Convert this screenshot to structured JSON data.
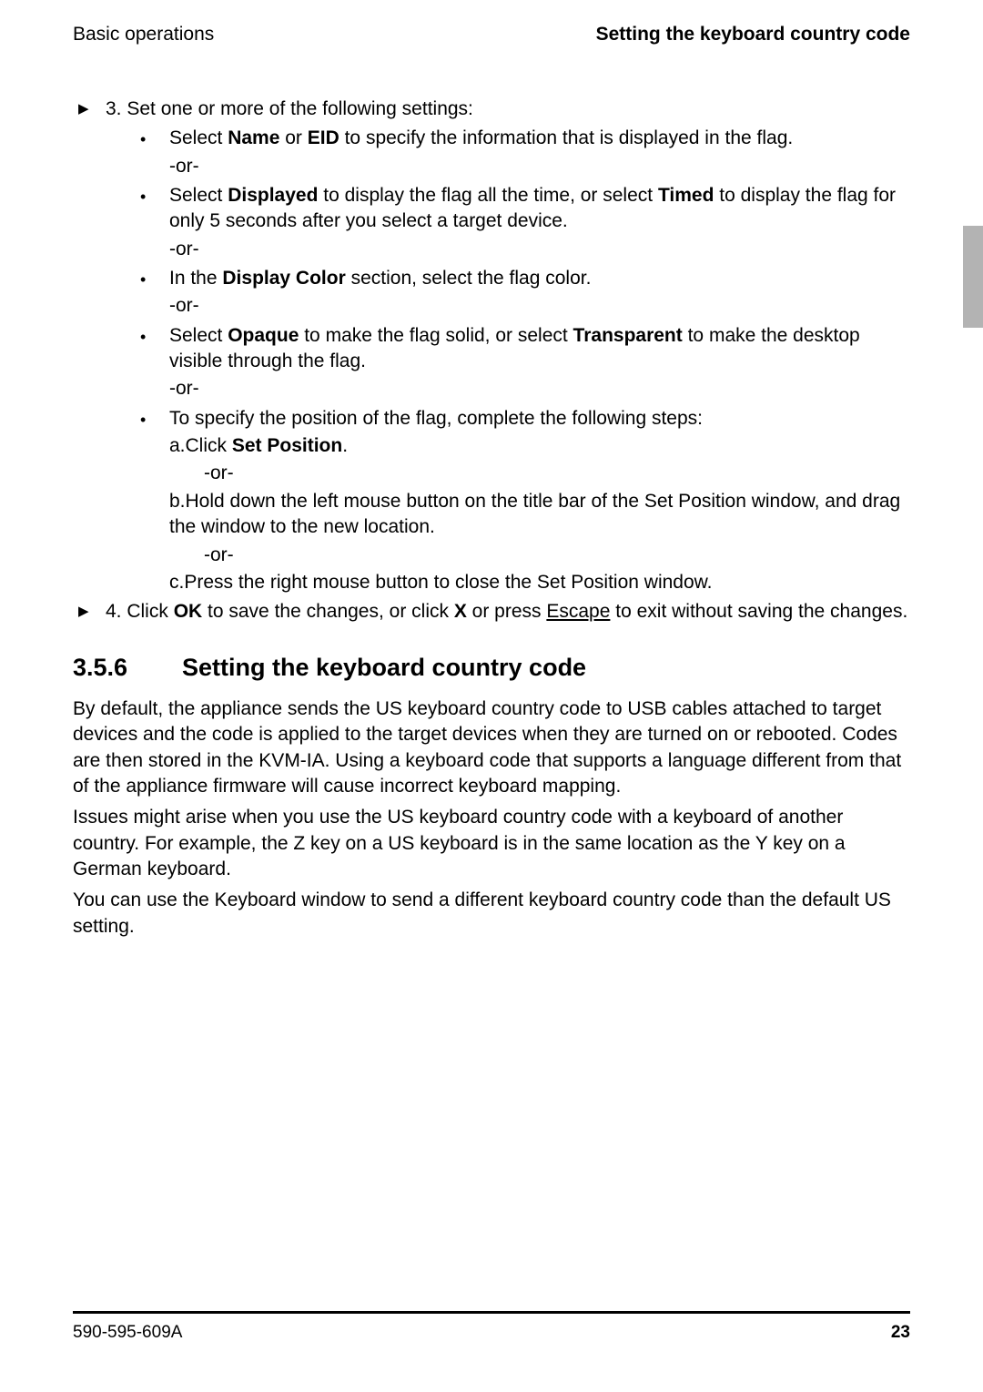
{
  "header": {
    "left": "Basic operations",
    "right": "Setting the keyboard country code"
  },
  "step3": {
    "intro": "3. Set one or more of the following settings:",
    "b1_pre": "Select ",
    "b1_name": "Name",
    "b1_mid": " or ",
    "b1_eid": "EID",
    "b1_post": " to specify the information that is displayed in the flag.",
    "b2_pre": "Select ",
    "b2_disp": "Displayed",
    "b2_mid": " to display the flag all the time, or select ",
    "b2_timed": "Timed",
    "b2_post": " to display the flag for only 5 seconds after you select a target device.",
    "b3_pre": "In the ",
    "b3_bold": "Display Color",
    "b3_post": " section, select the flag color.",
    "b4_pre": "Select ",
    "b4_op": "Opaque",
    "b4_mid": " to make the flag solid, or select ",
    "b4_tr": "Transparent",
    "b4_post": " to make the desktop visible through the flag.",
    "b5_intro": "To specify the position of the flag, complete the following steps:",
    "b5_a_pre": "a.Click ",
    "b5_a_bold": "Set Position",
    "b5_a_post": ".",
    "b5_b": "b.Hold down the left mouse button on the title bar of the Set Position window, and drag the window to the new location.",
    "b5_c": "c.Press the right mouse button to close the Set Position window.",
    "or": "-or-"
  },
  "step4": {
    "pre": "4. Click ",
    "ok": "OK",
    "mid1": " to save the changes, or click ",
    "x": "X",
    "mid2": " or press ",
    "esc": "Escape",
    "post": " to exit without saving the changes."
  },
  "section": {
    "num": "3.5.6",
    "title": "Setting the keyboard country code",
    "p1": "By default, the appliance sends the US keyboard country code to USB cables attached to target devices and the code is applied to the target devices when they are turned on or rebooted. Codes are then stored in the KVM-IA. Using a keyboard code that supports a language different from that of the appliance firmware will cause incorrect keyboard mapping.",
    "p2": "Issues might arise when you use the US keyboard country code with a keyboard of another country. For example, the Z key on a US keyboard is in the same location as the Y key on a German keyboard.",
    "p3": "You can use the Keyboard window to send a different keyboard country code than the default US setting."
  },
  "footer": {
    "doc": "590-595-609A",
    "page": "23"
  }
}
